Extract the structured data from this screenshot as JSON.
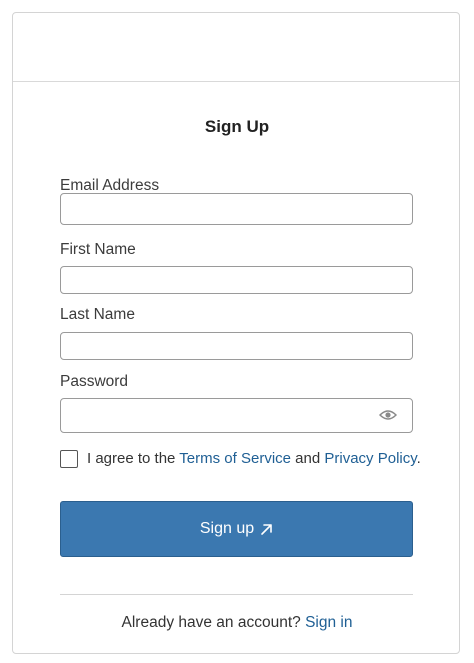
{
  "form": {
    "title": "Sign Up",
    "fields": {
      "email": {
        "label": "Email Address",
        "value": "",
        "placeholder": ""
      },
      "first_name": {
        "label": "First Name",
        "value": "",
        "placeholder": ""
      },
      "last_name": {
        "label": "Last Name",
        "value": "",
        "placeholder": ""
      },
      "password": {
        "label": "Password",
        "value": "",
        "placeholder": ""
      }
    },
    "agreement": {
      "prefix": "I agree to the ",
      "terms_link": "Terms of Service",
      "middle": " and ",
      "privacy_link": "Privacy Policy",
      "suffix": ".",
      "checked": false
    },
    "submit_label": "Sign up",
    "footer": {
      "prompt": "Already have an account? ",
      "sign_in_link": "Sign in"
    }
  },
  "icons": {
    "password_toggle": "eye-icon",
    "submit_arrow": "arrow-up-right-icon"
  },
  "colors": {
    "primary": "#3b78b0",
    "link": "#1f5f94",
    "border": "#9a9a9a"
  }
}
